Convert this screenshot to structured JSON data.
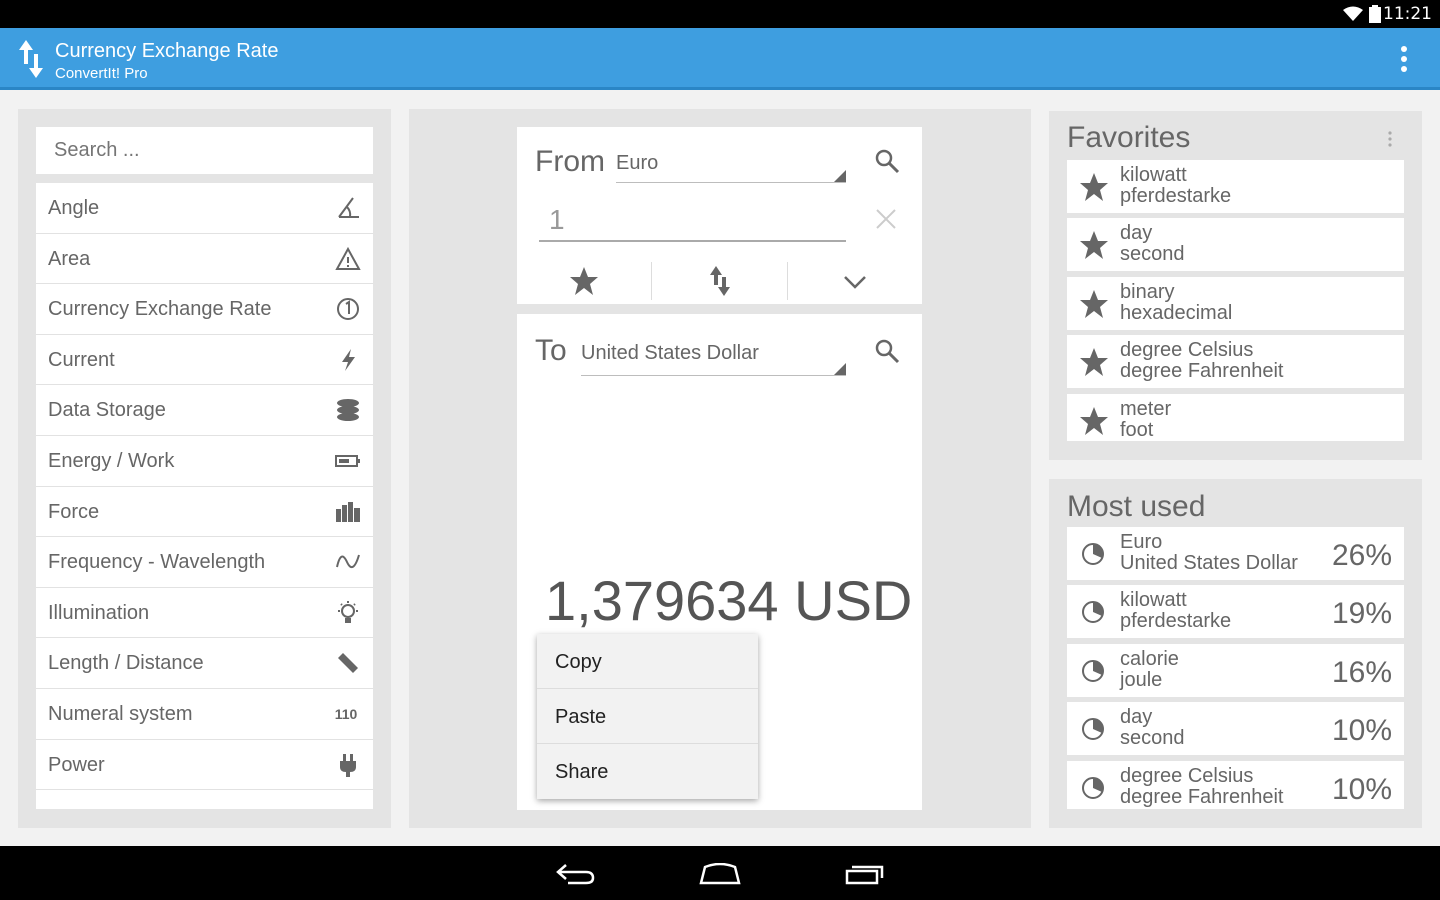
{
  "status_bar": {
    "time": "11:21"
  },
  "action_bar": {
    "title": "Currency Exchange Rate",
    "subtitle": "ConvertIt! Pro",
    "icon": "swap-vertical-icon",
    "overflow_icon": "more-vertical-icon"
  },
  "categories": {
    "search_placeholder": "Search ...",
    "items": [
      {
        "label": "Angle",
        "icon": "angle-icon"
      },
      {
        "label": "Area",
        "icon": "area-icon"
      },
      {
        "label": "Currency Exchange Rate",
        "icon": "currency-icon"
      },
      {
        "label": "Current",
        "icon": "lightning-icon"
      },
      {
        "label": "Data Storage",
        "icon": "database-icon"
      },
      {
        "label": "Energy / Work",
        "icon": "battery-icon"
      },
      {
        "label": "Force",
        "icon": "force-icon"
      },
      {
        "label": "Frequency - Wavelength",
        "icon": "wave-icon"
      },
      {
        "label": "Illumination",
        "icon": "bulb-icon"
      },
      {
        "label": "Length / Distance",
        "icon": "ruler-icon"
      },
      {
        "label": "Numeral system",
        "icon": "110"
      },
      {
        "label": "Power",
        "icon": "plug-icon"
      }
    ]
  },
  "converter": {
    "from_label": "From",
    "from_unit": "Euro",
    "input_value": "1",
    "to_label": "To",
    "to_unit": "United States Dollar",
    "result": "1,379634 USD"
  },
  "context_menu": [
    "Copy",
    "Paste",
    "Share"
  ],
  "favorites": {
    "title": "Favorites",
    "items": [
      {
        "from": "kilowatt",
        "to": "pferdestarke"
      },
      {
        "from": "day",
        "to": "second"
      },
      {
        "from": "binary",
        "to": "hexadecimal"
      },
      {
        "from": "degree Celsius",
        "to": "degree Fahrenheit"
      },
      {
        "from": "meter",
        "to": "foot"
      }
    ]
  },
  "most_used": {
    "title": "Most used",
    "items": [
      {
        "from": "Euro",
        "to": "United States Dollar",
        "percent": "26%"
      },
      {
        "from": "kilowatt",
        "to": "pferdestarke",
        "percent": "19%"
      },
      {
        "from": "calorie",
        "to": "joule",
        "percent": "16%"
      },
      {
        "from": "day",
        "to": "second",
        "percent": "10%"
      },
      {
        "from": "degree Celsius",
        "to": "degree Fahrenheit",
        "percent": "10%"
      }
    ]
  }
}
